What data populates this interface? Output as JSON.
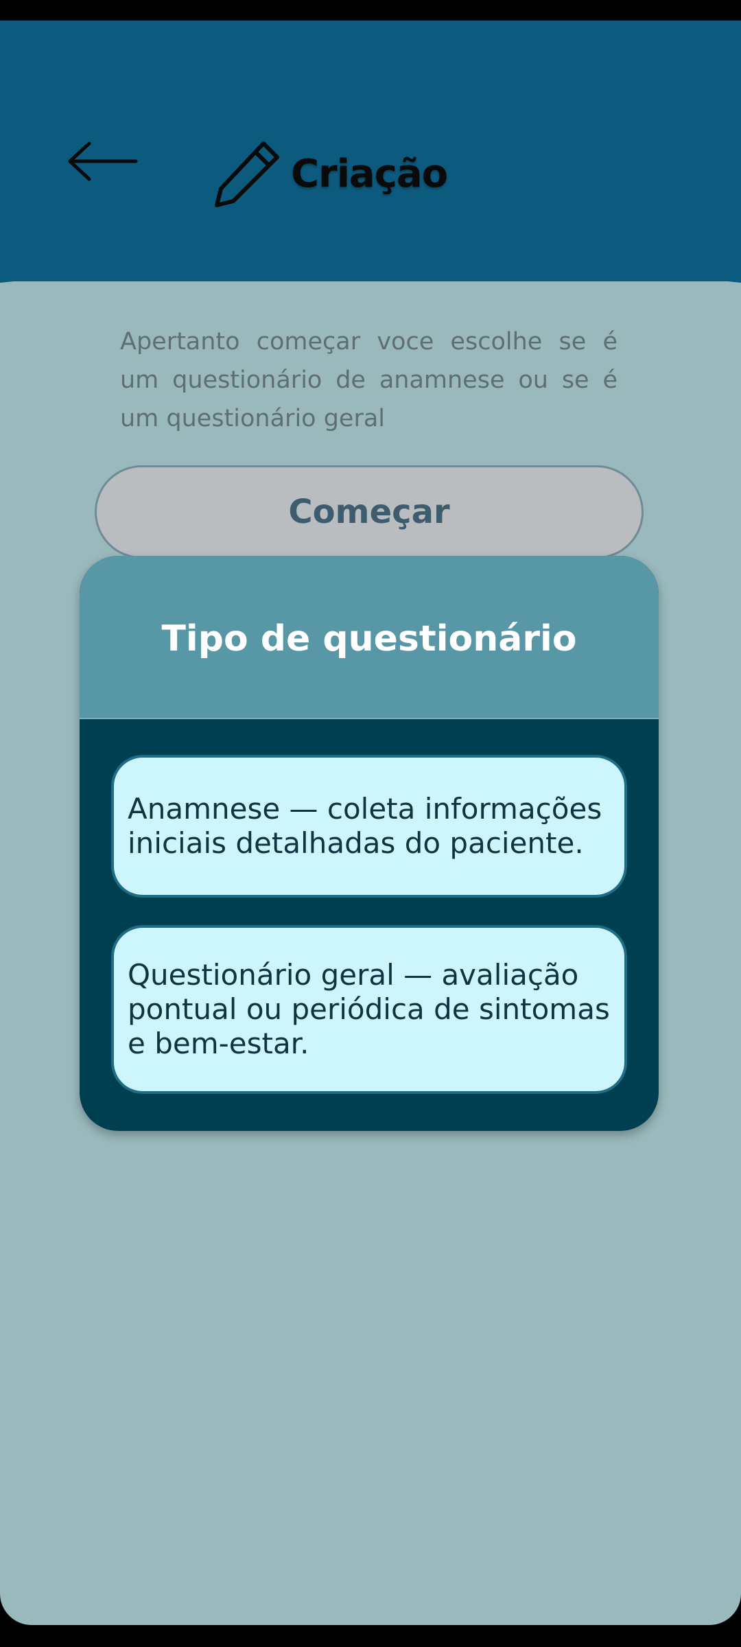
{
  "header": {
    "back_icon": "arrow-left-icon",
    "title_icon": "pencil-icon",
    "title": "Criação"
  },
  "main": {
    "description": "Apertanto começar voce escolhe se é um questionário de anamnese ou se é um questionário geral",
    "start_button_label": "Começar"
  },
  "modal": {
    "title": "Tipo de questionário",
    "options": [
      {
        "label": "Anamnese — coleta informações iniciais detalhadas do paciente."
      },
      {
        "label": "Questionário geral — avaliação pontual ou periódica de sintomas e bem-estar."
      }
    ]
  },
  "colors": {
    "header_bg": "#0d5a7f",
    "overlay_bg": "#99b9bd",
    "modal_head_bg": "#5897a5",
    "modal_body_bg": "#003f50",
    "option_bg": "#ccf6fb"
  }
}
